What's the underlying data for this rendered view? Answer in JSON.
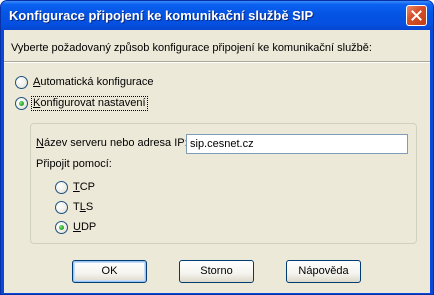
{
  "window": {
    "title": "Konfigurace připojení ke komunikační službě SIP"
  },
  "dialog": {
    "instruction": "Vyberte požadovaný způsob konfigurace připojení ke komunikační službě:",
    "mode_options": [
      {
        "label_accel": "A",
        "label_rest": "utomatická konfigurace",
        "selected": false
      },
      {
        "label_accel": "K",
        "label_rest": "onfigurovat nastavení",
        "selected": true
      }
    ],
    "server": {
      "label_accel": "N",
      "label_rest": "ázev serveru nebo adresa IP:",
      "value": "sip.cesnet.cz"
    },
    "connect_via": {
      "label": "Připojit pomocí:",
      "options": [
        {
          "label_before": "",
          "label_accel": "T",
          "label_rest": "CP",
          "selected": false
        },
        {
          "label_before": "T",
          "label_accel": "L",
          "label_rest": "S",
          "selected": false
        },
        {
          "label_before": "",
          "label_accel": "U",
          "label_rest": "DP",
          "selected": true
        }
      ]
    },
    "buttons": {
      "ok": "OK",
      "cancel": "Storno",
      "help": "Nápověda"
    }
  },
  "colors": {
    "title_bar": "#0554e4",
    "dialog_face": "#ece9d8",
    "close_button": "#d6502b",
    "radio_dot": "#21a121"
  },
  "icons": {
    "close": "close-icon"
  }
}
